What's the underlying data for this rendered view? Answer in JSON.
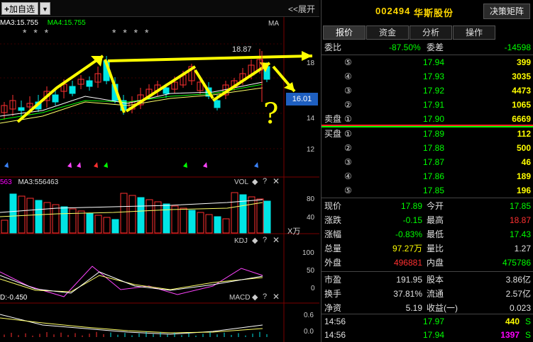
{
  "toolbar": {
    "add_label": "加自选",
    "expand_label": "<<展开"
  },
  "chart": {
    "ma3_label": "MA3:15.755",
    "ma4_label": "MA4:15.755",
    "ma_tag": "MA",
    "stars_left": "* * *",
    "stars_mid": "* * *   *",
    "high_price": "18.87",
    "price_ticks": [
      "18",
      "16.01",
      "14",
      "12"
    ],
    "current_price_box": "16.01",
    "vol_ma1": "563",
    "vol_ma3": "MA3:556463",
    "vol_tag": "VOL",
    "vol_ticks": [
      "80",
      "40"
    ],
    "vol_unit": "X万",
    "kdj_tag": "KDJ",
    "kdj_ticks": [
      "100",
      "50",
      "0"
    ],
    "macd_label": "D:-0.450",
    "macd_tag": "MACD",
    "macd_ticks": [
      "0.6",
      "0.0"
    ],
    "question_mark": "?",
    "annotation_note": "?"
  },
  "stock": {
    "code": "002494",
    "name": "华斯股份",
    "decision_button": "决策矩阵"
  },
  "tabs": [
    "报价",
    "资金",
    "分析",
    "操作"
  ],
  "weibi": {
    "label": "委比",
    "value": "-87.50%",
    "diff_label": "委差",
    "diff": "-14598"
  },
  "asks": [
    {
      "idx": "⑤",
      "price": "17.94",
      "vol": "399"
    },
    {
      "idx": "④",
      "price": "17.93",
      "vol": "3035"
    },
    {
      "idx": "③",
      "price": "17.92",
      "vol": "4473"
    },
    {
      "idx": "②",
      "price": "17.91",
      "vol": "1065"
    },
    {
      "idx": "①",
      "price": "17.90",
      "vol": "6669",
      "label": "卖盘"
    }
  ],
  "bids": [
    {
      "idx": "①",
      "price": "17.89",
      "vol": "112",
      "label": "买盘"
    },
    {
      "idx": "②",
      "price": "17.88",
      "vol": "500"
    },
    {
      "idx": "③",
      "price": "17.87",
      "vol": "46"
    },
    {
      "idx": "④",
      "price": "17.86",
      "vol": "189"
    },
    {
      "idx": "⑤",
      "price": "17.85",
      "vol": "196"
    }
  ],
  "stats": [
    {
      "l1": "现价",
      "v1": "17.89",
      "l2": "今开",
      "v2": "17.85",
      "c1": "green",
      "c2": "green"
    },
    {
      "l1": "涨跌",
      "v1": "-0.15",
      "l2": "最高",
      "v2": "18.87",
      "c1": "green",
      "c2": "red"
    },
    {
      "l1": "涨幅",
      "v1": "-0.83%",
      "l2": "最低",
      "v2": "17.43",
      "c1": "green",
      "c2": "green"
    },
    {
      "l1": "总量",
      "v1": "97.27万",
      "l2": "量比",
      "v2": "1.27",
      "c1": "yellow",
      "c2": "white"
    },
    {
      "l1": "外盘",
      "v1": "496881",
      "l2": "内盘",
      "v2": "475786",
      "c1": "red",
      "c2": "green"
    }
  ],
  "stats2": [
    {
      "l1": "市盈",
      "v1": "191.95",
      "l2": "股本",
      "v2": "3.86亿"
    },
    {
      "l1": "换手",
      "v1": "37.81%",
      "l2": "流通",
      "v2": "2.57亿"
    },
    {
      "l1": "净资",
      "v1": "5.19",
      "l2": "收益(一)",
      "v2": "0.023"
    }
  ],
  "ticks": [
    {
      "time": "14:56",
      "price": "17.97",
      "vol": "440",
      "flag": "S"
    },
    {
      "time": "14:56",
      "price": "17.94",
      "vol": "1397",
      "flag": "S"
    }
  ],
  "colors": {
    "up": "#ff3030",
    "down": "#00ffff",
    "annotation": "#ffff00"
  }
}
